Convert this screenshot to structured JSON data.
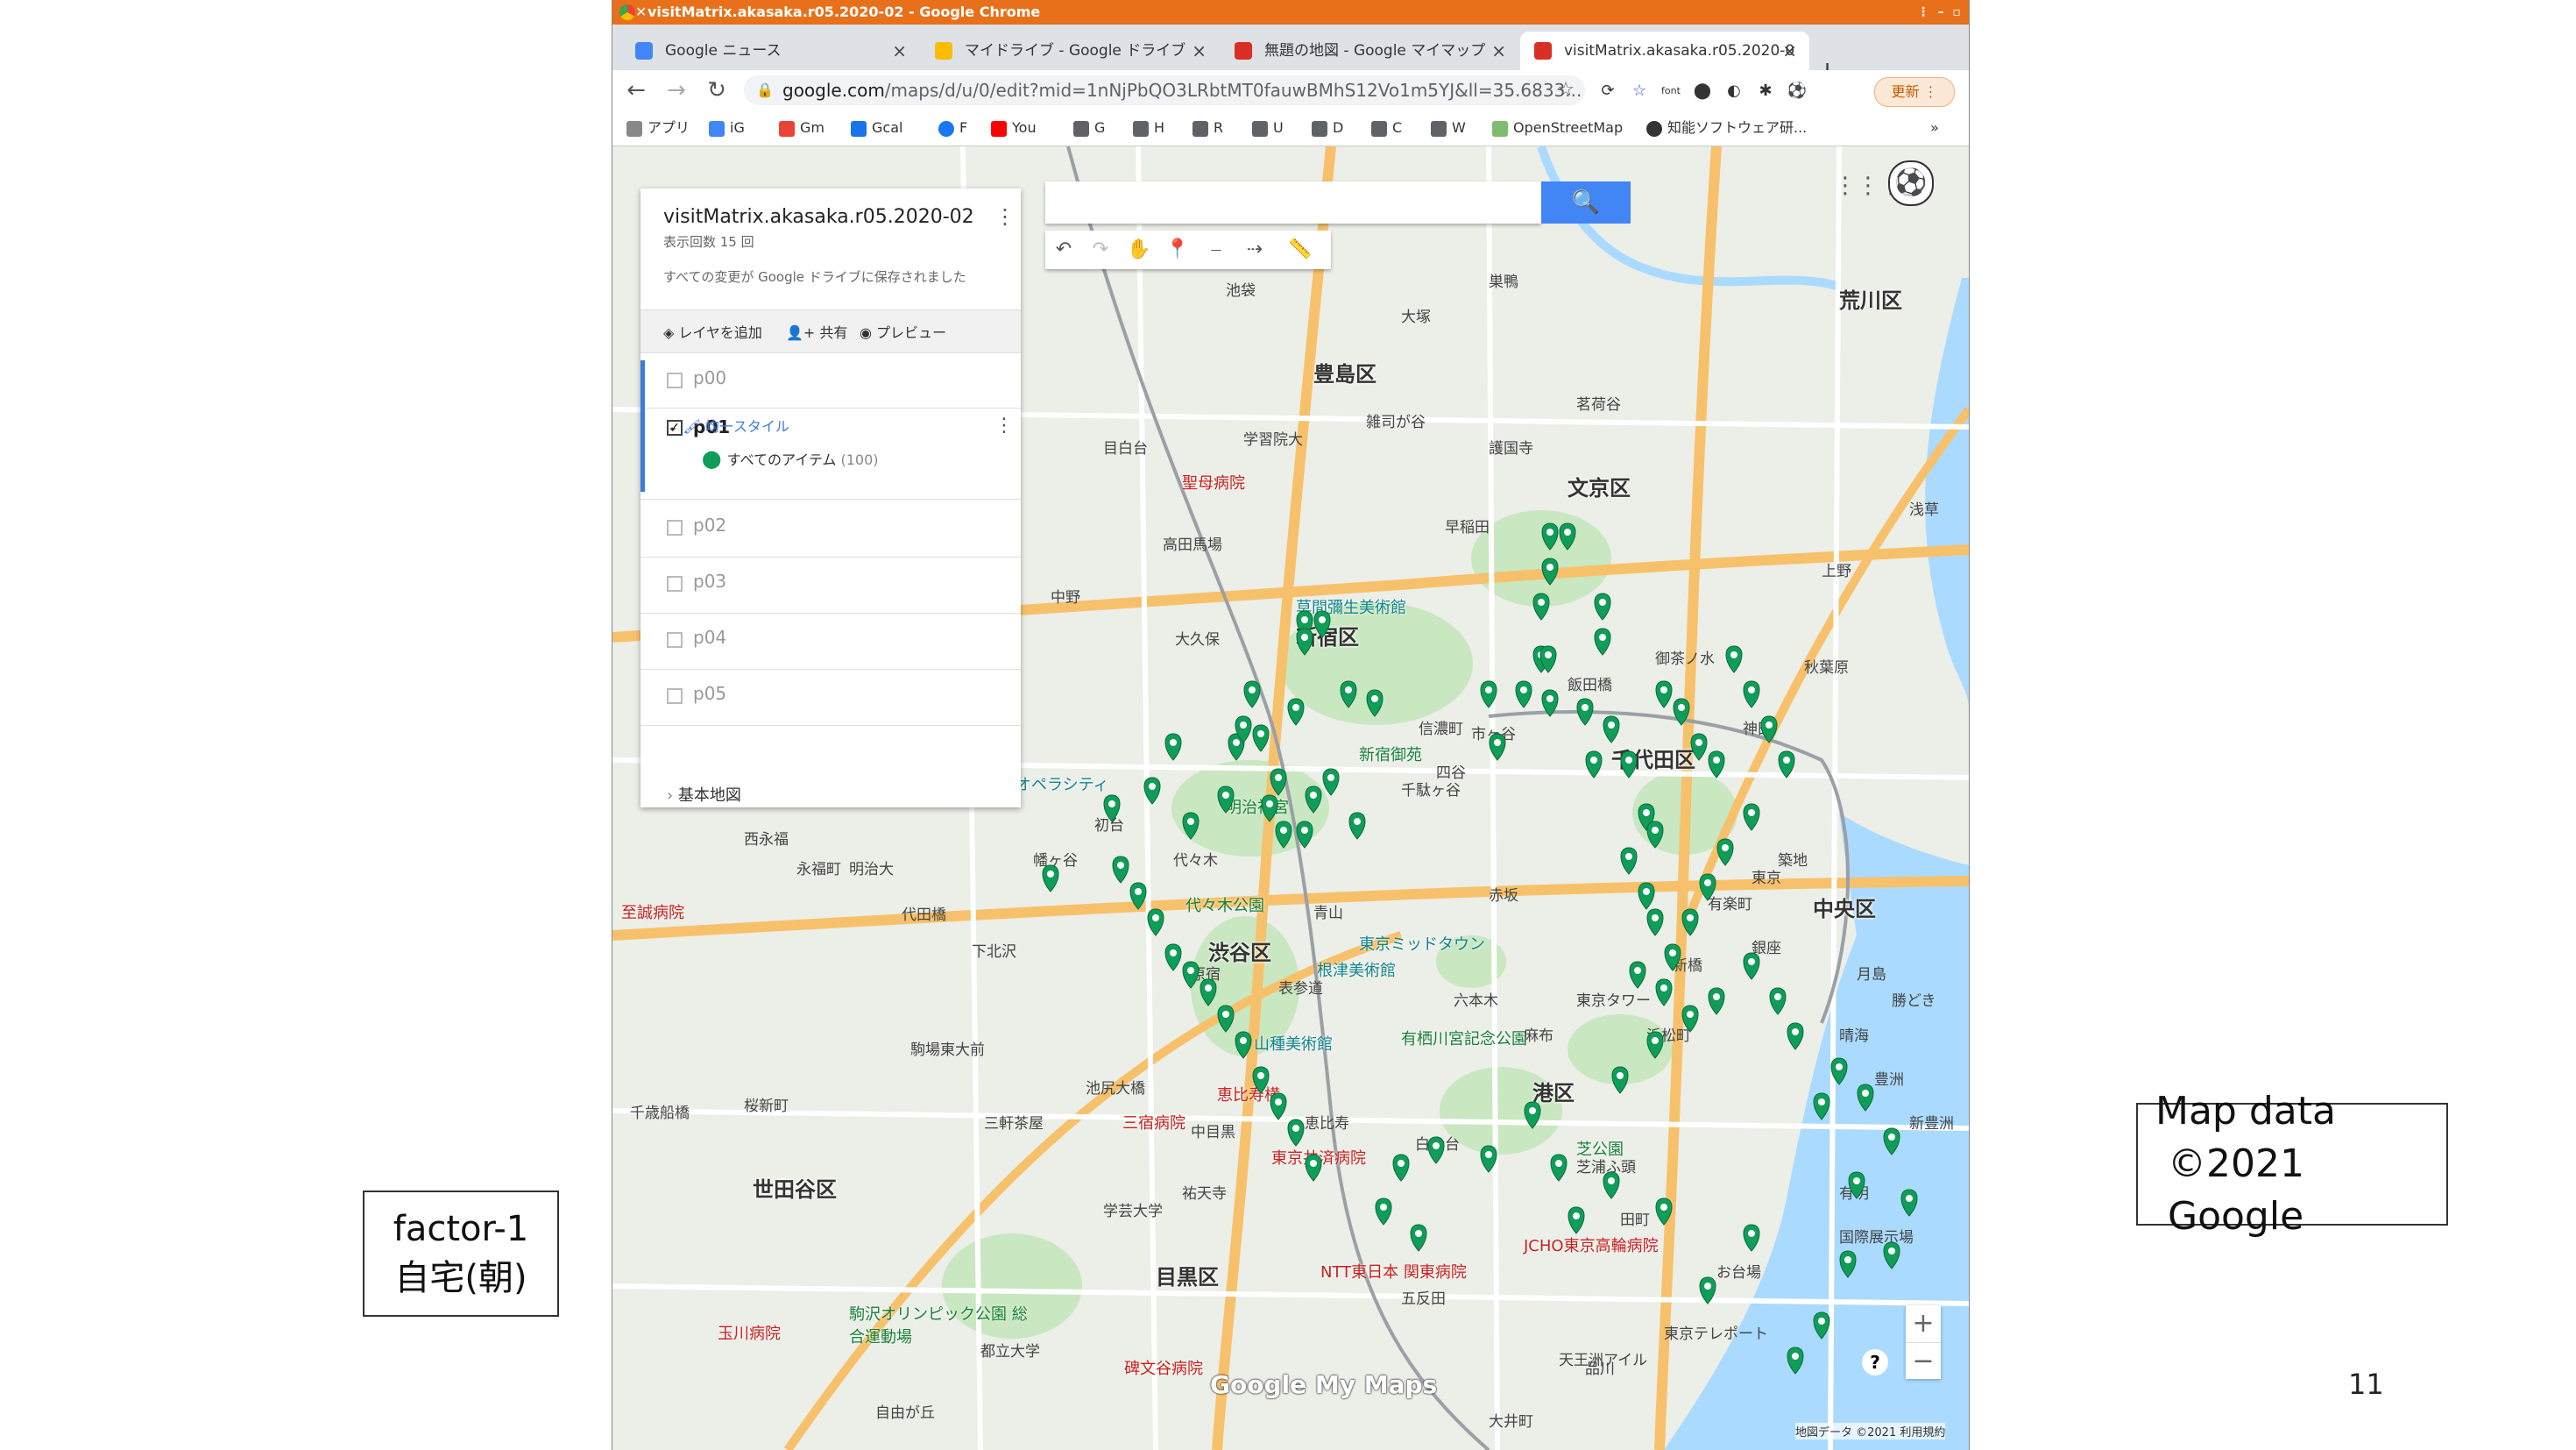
{
  "slide": {
    "factor_line1": "factor-1",
    "factor_line2": "自宅(朝)",
    "credit_line1": "Map data",
    "credit_line2": "©2021 Google",
    "page_number": "11"
  },
  "browser": {
    "window_title": "visitMatrix.akasaka.r05.2020-02 - Google Chrome",
    "tabs": [
      {
        "label": "Google ニュース",
        "color": "#4285f4"
      },
      {
        "label": "マイドライブ - Google ドライブ",
        "color": "#fbbc04"
      },
      {
        "label": "無題の地図 - Google マイマップ",
        "color": "#d93025"
      },
      {
        "label": "visitMatrix.akasaka.r05.2020-0",
        "color": "#d93025"
      }
    ],
    "url_host": "google.com",
    "url_path": "/maps/d/u/0/edit?mid=1nNjPbQO3LRbtMT0fauwBMhS12Vo1m5YJ&ll=35.6833...",
    "update_label": "更新",
    "bookmarks": [
      "アプリ",
      "iG",
      "Gm",
      "Gcal",
      "F",
      "You",
      "G",
      "H",
      "R",
      "U",
      "D",
      "C",
      "W",
      "OpenStreetMap",
      "知能ソフトウェア研..."
    ]
  },
  "panel": {
    "title": "visitMatrix.akasaka.r05.2020-02",
    "views": "表示回数 15 回",
    "save_status": "すべての変更が Google ドライブに保存されました",
    "actions": {
      "add_layer": "レイヤを追加",
      "share": "共有",
      "preview": "プレビュー"
    },
    "layers": {
      "p00": "p00",
      "p01": "p01",
      "p02": "p02",
      "p03": "p03",
      "p04": "p04",
      "p05": "p05"
    },
    "style": "均一スタイル",
    "all_items": "すべてのアイテム",
    "item_count": "(100)",
    "basemap": "基本地図"
  },
  "map": {
    "wards": [
      "豊島区",
      "文京区",
      "荒川区",
      "新宿区",
      "千代田区",
      "中央区",
      "渋谷区",
      "港区",
      "目黒区",
      "世田谷区"
    ],
    "pois_red": [
      "聖母病院",
      "東京共済病院",
      "三宿病院",
      "JCHO東京高輪病院",
      "NTT東日本 関東病院",
      "玉川病院",
      "至誠病院",
      "碑文谷病院",
      "恵比寿横"
    ],
    "pois_green": [
      "新宿御苑",
      "明治神宮",
      "代々木公園",
      "駒沢オリンピック公園 総合運動場",
      "有栖川宮記念公園",
      "芝公園"
    ],
    "pois_teal": [
      "東京オペラシティ",
      "根津美術館",
      "山種美術館",
      "草間彌生美術館",
      "東京ミッドタウン"
    ],
    "labels": [
      "池袋",
      "目白台",
      "早稲田",
      "高田馬場",
      "大久保",
      "中野",
      "初台",
      "幡ヶ谷",
      "西永福",
      "永福町",
      "明治大",
      "代田橋",
      "下北沢",
      "三軒茶屋",
      "池尻大橋",
      "中目黒",
      "恵比寿",
      "白金台",
      "五反田",
      "品川",
      "田町",
      "浜松町",
      "新橋",
      "銀座",
      "有楽町",
      "東京",
      "神田",
      "秋葉原",
      "上野",
      "浅草",
      "御茶ノ水",
      "飯田橋",
      "市ヶ谷",
      "四谷",
      "赤坂",
      "六本木",
      "麻布",
      "青山",
      "表参道",
      "原宿",
      "代々木",
      "千駄ヶ谷",
      "信濃町",
      "護国寺",
      "茗荷谷",
      "巣鴨",
      "大塚",
      "雑司が谷",
      "学習院大",
      "千歳船橋",
      "桜新町",
      "駒場東大前",
      "都立大学",
      "自由が丘",
      "学芸大学",
      "祐天寺",
      "東京タワー",
      "お台場",
      "豊洲",
      "月島",
      "築地",
      "勝どき",
      "晴海",
      "有明",
      "東京テレポート",
      "国際展示場",
      "新豊洲",
      "芝浦ふ頭",
      "天王洲アイル",
      "大井町"
    ],
    "search_button": "🔍",
    "tools": [
      "↶",
      "↷",
      "✋",
      "📍",
      "⎯",
      "⇢",
      "📏"
    ],
    "logo": "Google My Maps",
    "attribution": "地図データ ©2021 利用規約",
    "zoom_in": "+",
    "zoom_out": "−",
    "help": "?"
  }
}
